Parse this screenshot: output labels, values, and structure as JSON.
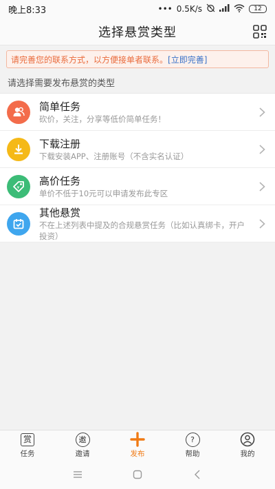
{
  "status_bar": {
    "time": "晚上8:33",
    "dots": "•••",
    "speed": "0.5K/s",
    "battery": "12"
  },
  "nav": {
    "title": "选择悬赏类型"
  },
  "notice": {
    "text": "请完善您的联系方式，以方便接单者联系。",
    "link": "[立即完善]"
  },
  "section_label": "请选择需要发布悬赏的类型",
  "types": [
    {
      "title": "简单任务",
      "desc": "砍价，关注，分享等低价简单任务！",
      "color": "#f36c4b",
      "icon": "users-icon"
    },
    {
      "title": "下载注册",
      "desc": "下载安装APP、注册账号（不含实名认证）",
      "color": "#f5b918",
      "icon": "download-icon"
    },
    {
      "title": "高价任务",
      "desc": "单价不低于10元可以申请发布此专区",
      "color": "#3cbc77",
      "icon": "price-tag-icon"
    },
    {
      "title": "其他悬赏",
      "desc": "不在上述列表中提及的合规悬赏任务（比如认真绑卡，开户投资）",
      "color": "#3fa6ee",
      "icon": "calendar-check-icon"
    }
  ],
  "tabs": [
    {
      "label": "任务",
      "glyph": "赏",
      "icon": "reward-icon",
      "active": false
    },
    {
      "label": "邀请",
      "glyph": "邀",
      "icon": "invite-icon",
      "active": false
    },
    {
      "label": "发布",
      "glyph": "+",
      "icon": "plus-icon",
      "active": true
    },
    {
      "label": "帮助",
      "glyph": "?",
      "icon": "help-icon",
      "active": false
    },
    {
      "label": "我的",
      "glyph": "",
      "icon": "user-icon",
      "active": false
    }
  ],
  "colors": {
    "accent": "#f07a14",
    "notice_text": "#e96b3c",
    "link": "#3a72c8"
  }
}
